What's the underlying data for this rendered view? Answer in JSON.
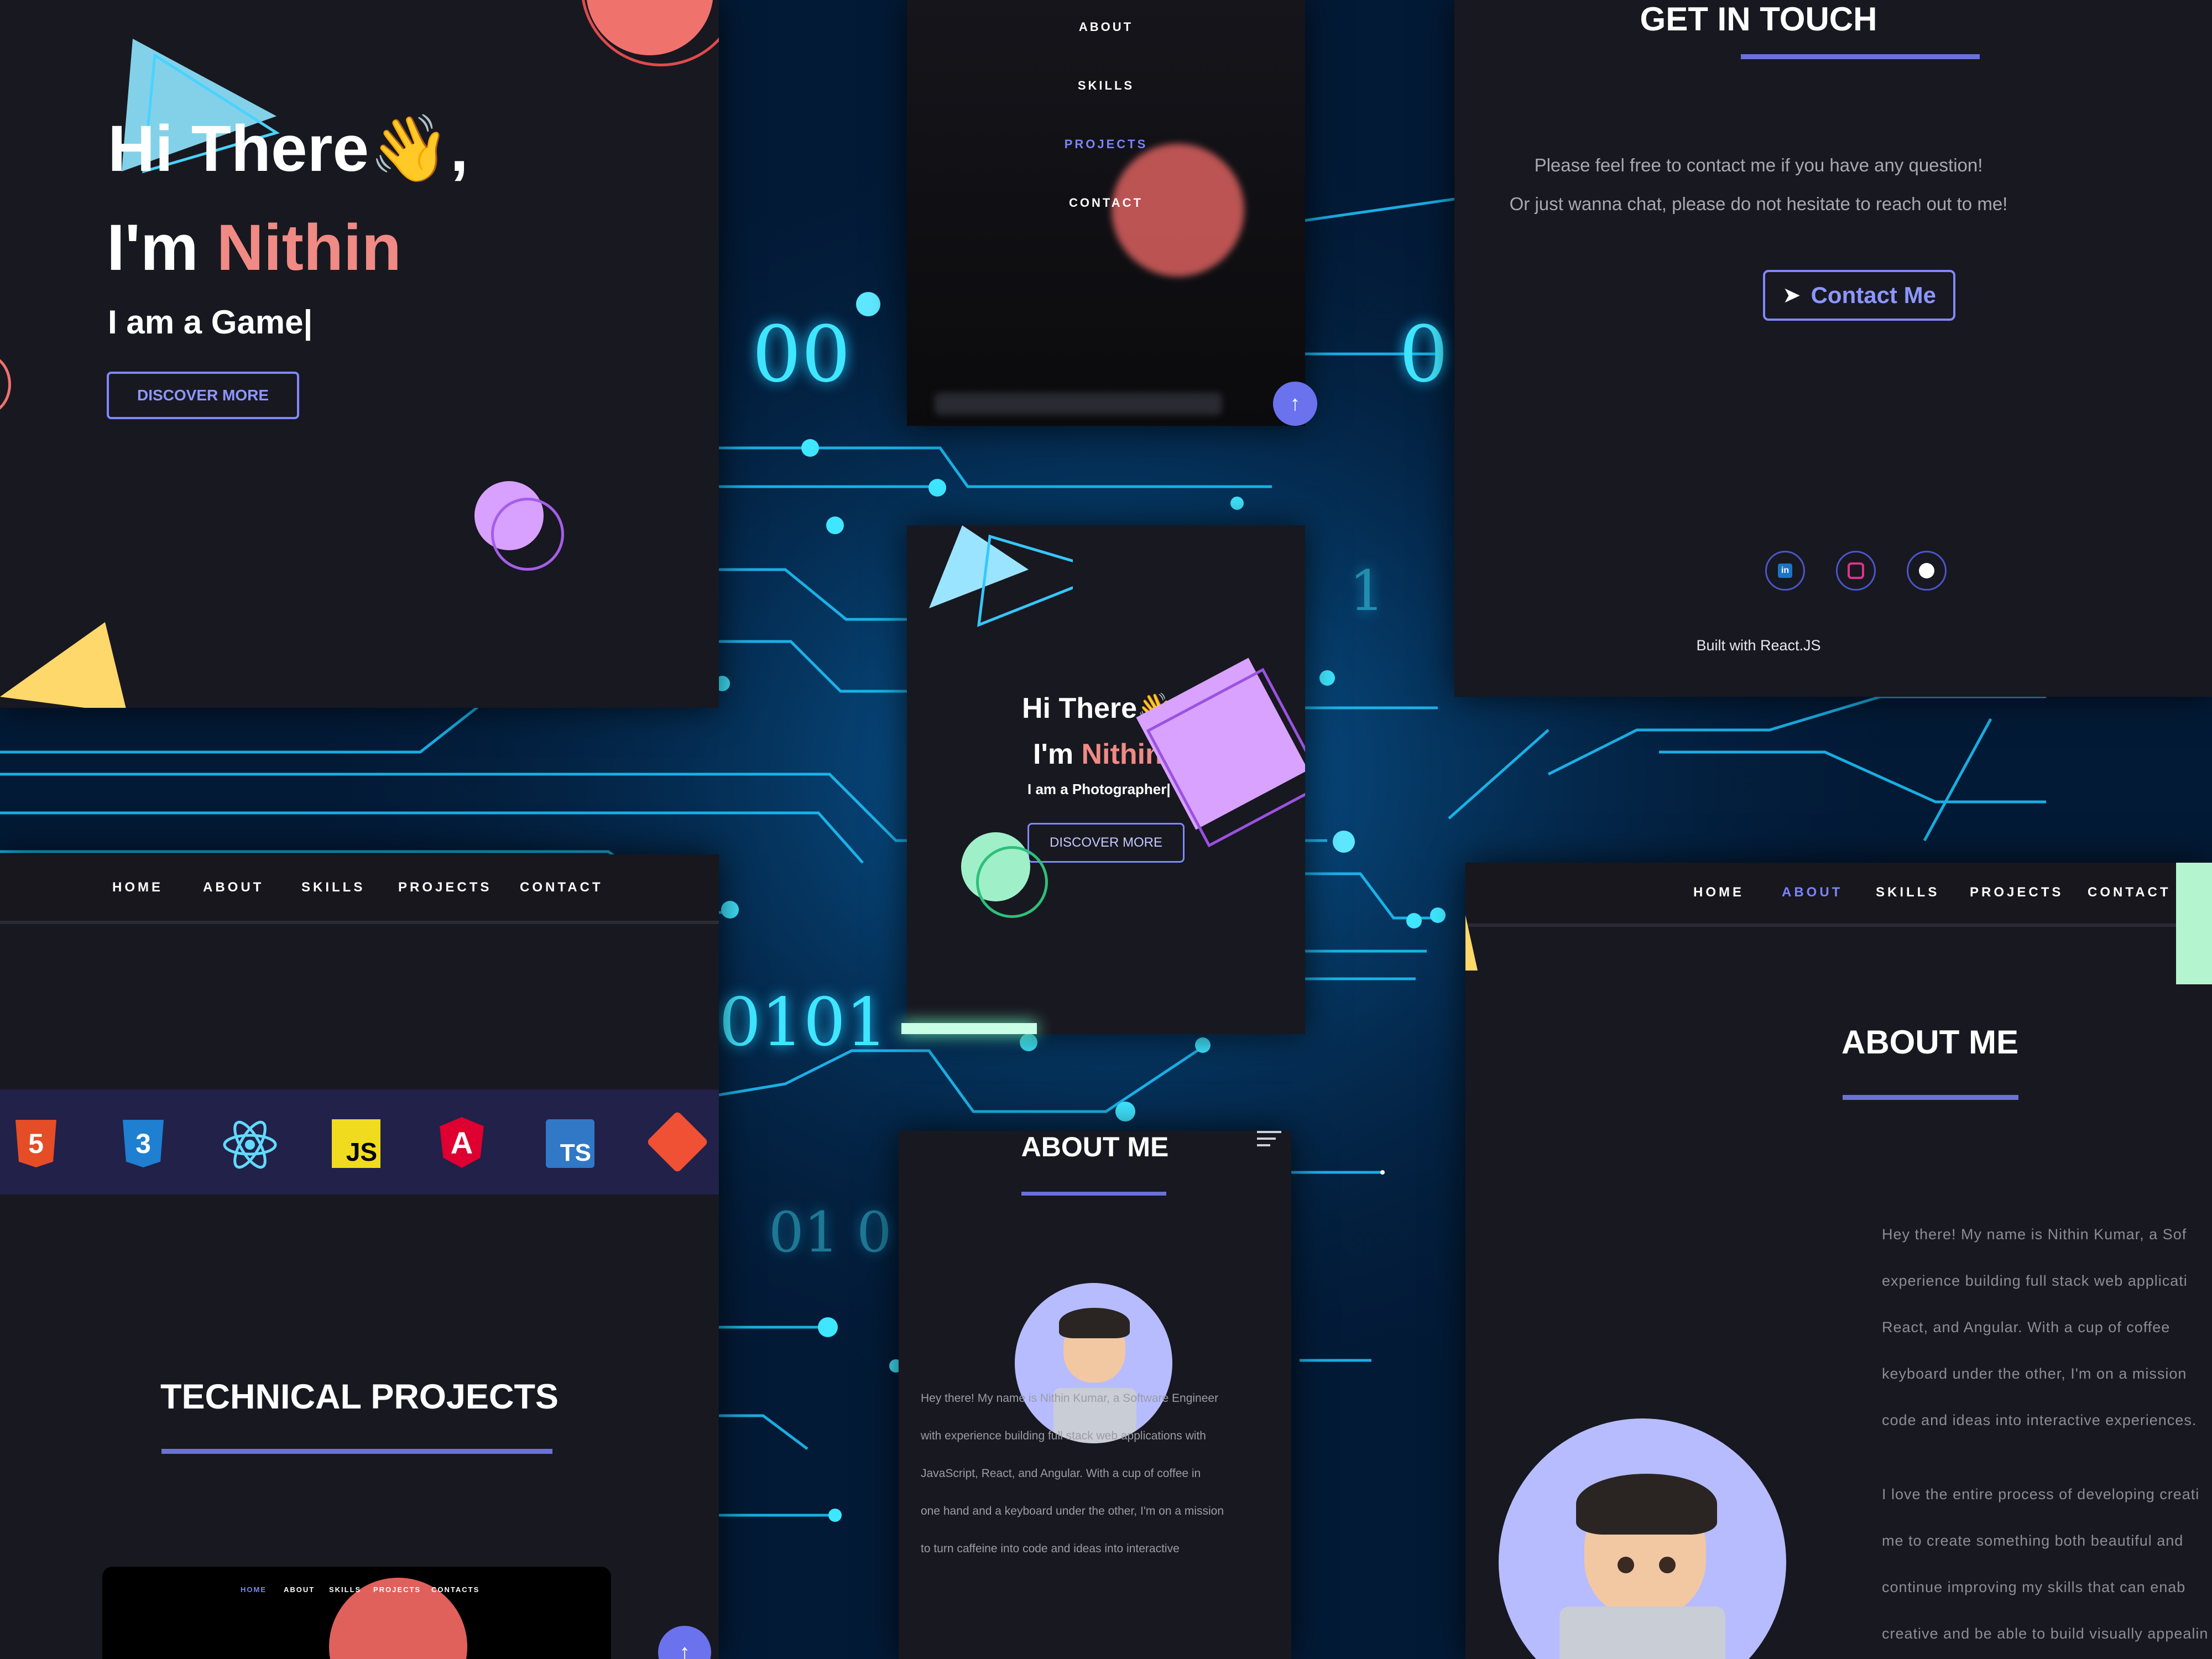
{
  "hero_panel": {
    "greeting": "Hi There",
    "wave_emoji": "👋",
    "comma": ",",
    "im_prefix": "I'm ",
    "name": "Nithin",
    "typing_text": "I am a Game",
    "cursor": "|",
    "discover_button": "DISCOVER MORE"
  },
  "phone_top": {
    "menu": [
      "ABOUT",
      "SKILLS",
      "PROJECTS",
      "CONTACT"
    ],
    "active_item": "PROJECTS"
  },
  "contact_panel": {
    "title": "GET IN TOUCH",
    "line1": "Please feel free to contact me if you have any question!",
    "line2": "Or just wanna chat, please do not hesitate to reach out to me!",
    "contact_button": "Contact Me",
    "socials": [
      "linkedin-icon",
      "instagram-icon",
      "github-icon"
    ],
    "footer": "Built with React.JS"
  },
  "phone_hero": {
    "greeting": "Hi There",
    "wave_emoji": "👋",
    "comma": ",",
    "im_prefix": "I'm ",
    "name": "Nithin",
    "typing_text": "I am a Photographer",
    "cursor": "|",
    "discover_button": "DISCOVER MORE"
  },
  "skills_panel": {
    "nav": [
      "HOME",
      "ABOUT",
      "SKILLS",
      "PROJECTS",
      "CONTACT"
    ],
    "skill_icons": [
      {
        "name": "html5-icon",
        "label": "5",
        "color": "#e44d26"
      },
      {
        "name": "css3-icon",
        "label": "3",
        "color": "#1572b6"
      },
      {
        "name": "react-icon",
        "label": "",
        "color": "#61dafb"
      },
      {
        "name": "javascript-icon",
        "label": "JS",
        "color": "#f0db1f"
      },
      {
        "name": "angular-icon",
        "label": "A",
        "color": "#dd0031"
      },
      {
        "name": "typescript-icon",
        "label": "TS",
        "color": "#3178c6"
      },
      {
        "name": "git-icon",
        "label": "",
        "color": "#f05033"
      }
    ],
    "section_title": "TECHNICAL PROJECTS",
    "mini_nav": [
      "HOME",
      "ABOUT",
      "SKILLS",
      "PROJECTS",
      "CONTACTS"
    ]
  },
  "about_phone": {
    "title": "ABOUT ME",
    "text_lines": [
      "Hey there! My name is Nithin Kumar, a Software Engineer",
      "with experience building full stack web applications with",
      "JavaScript, React, and Angular. With a cup of coffee in",
      "one hand and a keyboard under the other, I'm on a mission",
      "to turn caffeine into code and ideas into interactive"
    ]
  },
  "about_panel": {
    "nav": [
      "HOME",
      "ABOUT",
      "SKILLS",
      "PROJECTS",
      "CONTACT"
    ],
    "active_item": "ABOUT",
    "title": "ABOUT ME",
    "para1": [
      "Hey there! My name is Nithin Kumar, a Sof",
      "experience building full stack web applicati",
      "React, and Angular. With a cup of coffee",
      "keyboard under the other, I'm on a mission",
      "code and ideas into interactive experiences."
    ],
    "para2": [
      "I love the entire process of developing creati",
      "me to create something both beautiful and",
      "continue improving my skills that can enab",
      "creative and be able to build visually appealin"
    ]
  },
  "background_binary": [
    "00",
    "0",
    "1",
    "0101",
    "01 0"
  ],
  "colors": {
    "accent": "#6a72d9",
    "name_pink": "#f08a84",
    "panel_bg": "#181820",
    "circuit": "#1ec8ff"
  }
}
